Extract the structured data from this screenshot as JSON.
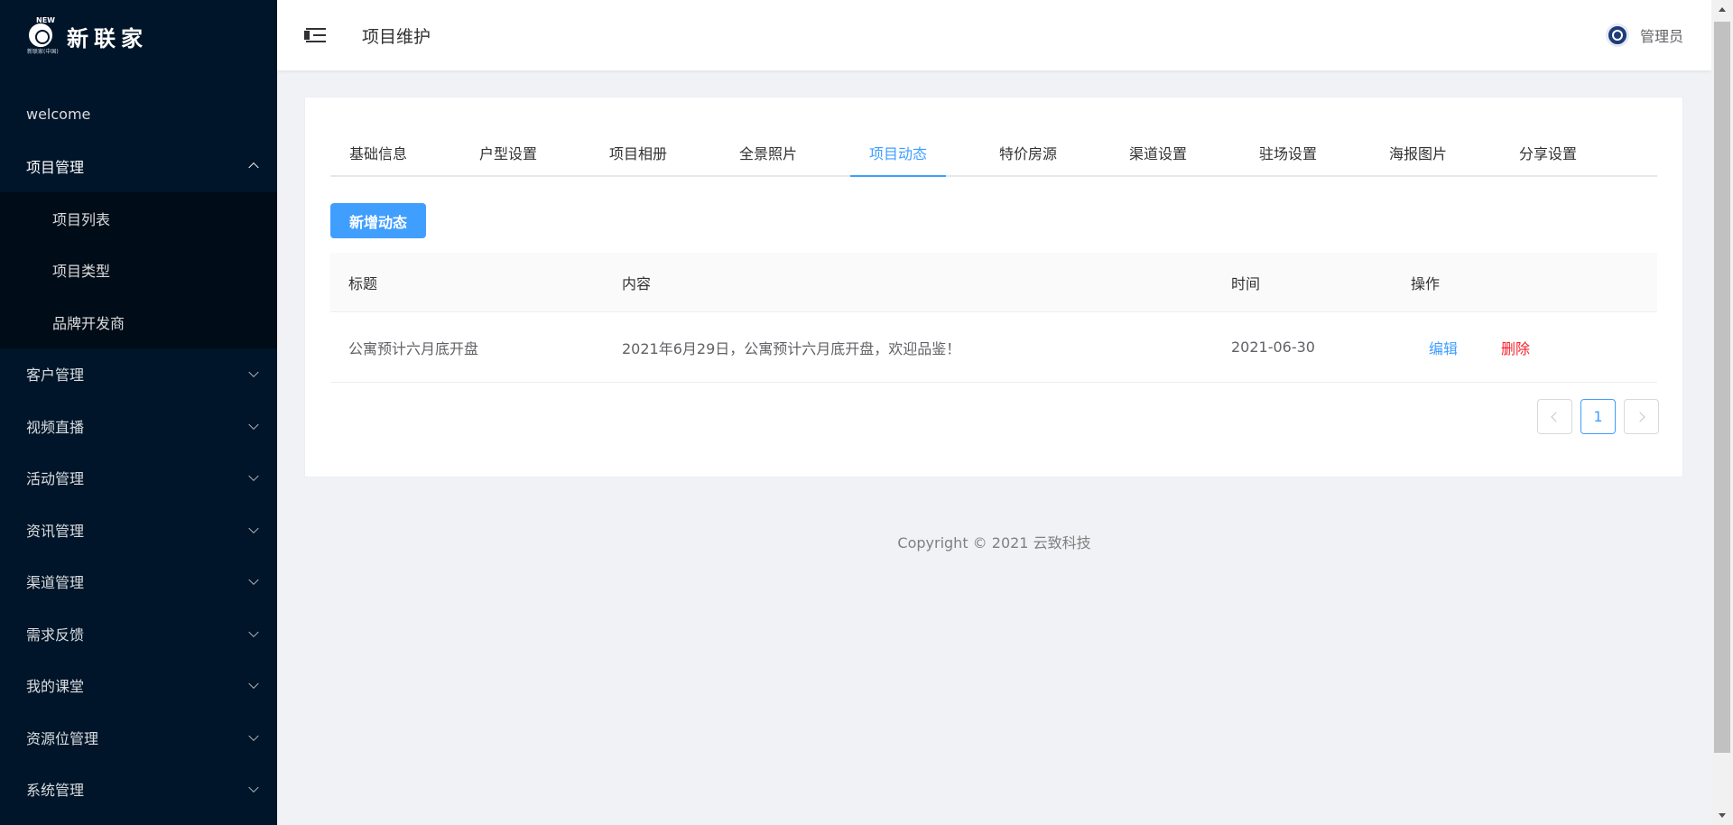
{
  "logo": {
    "text": "新联家",
    "mark_top": "NEW",
    "mark_bottom": "新联家(中国)"
  },
  "sidebar": {
    "items": [
      {
        "label": "welcome"
      },
      {
        "label": "项目管理",
        "open": true,
        "children": [
          "项目列表",
          "项目类型",
          "品牌开发商"
        ]
      },
      {
        "label": "客户管理"
      },
      {
        "label": "视频直播"
      },
      {
        "label": "活动管理"
      },
      {
        "label": "资讯管理"
      },
      {
        "label": "渠道管理"
      },
      {
        "label": "需求反馈"
      },
      {
        "label": "我的课堂"
      },
      {
        "label": "资源位管理"
      },
      {
        "label": "系统管理"
      }
    ]
  },
  "header": {
    "title": "项目维护",
    "user_name": "管理员"
  },
  "tabs": [
    "基础信息",
    "户型设置",
    "项目相册",
    "全景照片",
    "项目动态",
    "特价房源",
    "渠道设置",
    "驻场设置",
    "海报图片",
    "分享设置"
  ],
  "active_tab": "项目动态",
  "add_button": "新增动态",
  "table": {
    "columns": [
      "标题",
      "内容",
      "时间",
      "操作"
    ],
    "rows": [
      {
        "title": "公寓预计六月底开盘",
        "content": "2021年6月29日，公寓预计六月底开盘，欢迎品鉴！",
        "time": "2021-06-30",
        "edit": "编辑",
        "delete": "删除"
      }
    ]
  },
  "pagination": {
    "current": "1"
  },
  "footer": "Copyright © 2021 云致科技",
  "colors": {
    "sidebar": "#001529",
    "primary": "#409eff",
    "danger": "#f5222d"
  },
  "icons": {
    "fold": "menu-fold-icon",
    "avatar": "avatar-icon"
  }
}
